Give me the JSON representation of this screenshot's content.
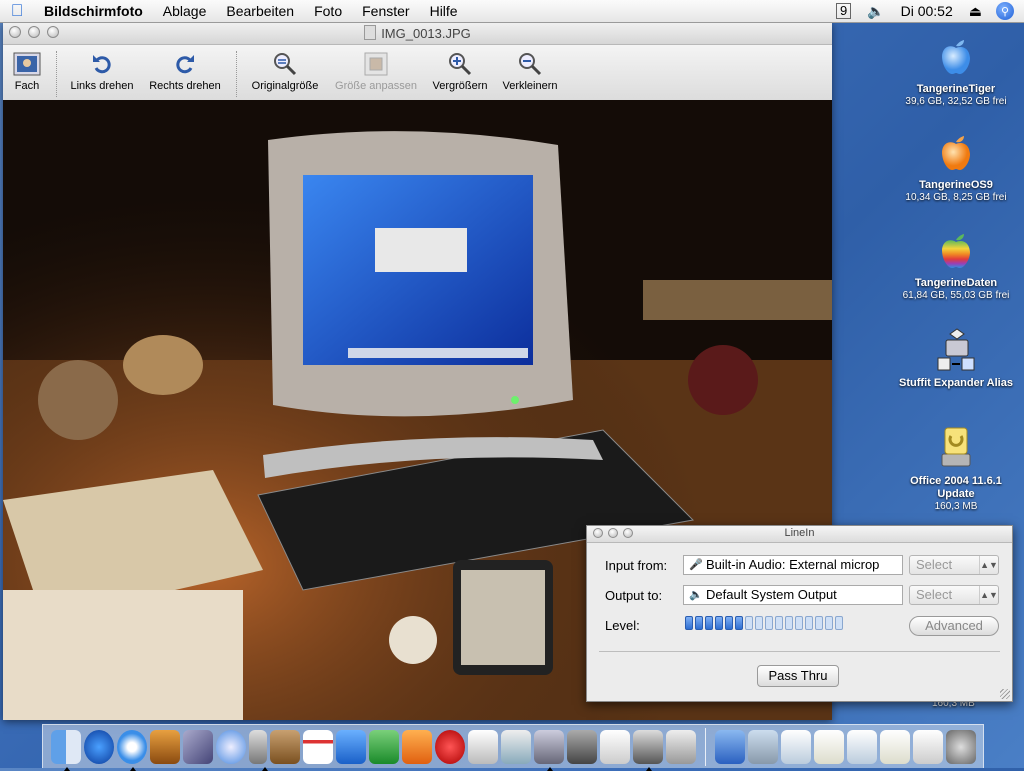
{
  "menubar": {
    "app": "Bildschirmfoto",
    "items": [
      "Ablage",
      "Bearbeiten",
      "Foto",
      "Fenster",
      "Hilfe"
    ],
    "clock": "Di 00:52"
  },
  "preview": {
    "title": "IMG_0013.JPG",
    "toolbar": {
      "fach": "Fach",
      "links": "Links drehen",
      "rechts": "Rechts drehen",
      "original": "Originalgröße",
      "fit": "Größe anpassen",
      "zoom_in": "Vergrößern",
      "zoom_out": "Verkleinern"
    }
  },
  "desktop": [
    {
      "name": "TangerineTiger",
      "sub": "39,6 GB, 32,52 GB frei"
    },
    {
      "name": "TangerineOS9",
      "sub": "10,34 GB, 8,25 GB frei"
    },
    {
      "name": "TangerineDaten",
      "sub": "61,84 GB, 55,03 GB frei"
    },
    {
      "name": "Stuffit Expander Alias",
      "sub": ""
    },
    {
      "name": "Office 2004 11.6.1 Update",
      "sub": "160,3 MB"
    }
  ],
  "covered_label": "160,3 MB",
  "linein": {
    "title": "LineIn",
    "input_label": "Input from:",
    "input_value": "Built-in Audio: External microp",
    "output_label": "Output to:",
    "output_value": "Default System Output",
    "select": "Select",
    "level_label": "Level:",
    "level": 0.38,
    "advanced": "Advanced",
    "pass_thru": "Pass Thru"
  },
  "colors": {
    "accent": "#2f6fd1",
    "desktop": "#3b6db8"
  }
}
